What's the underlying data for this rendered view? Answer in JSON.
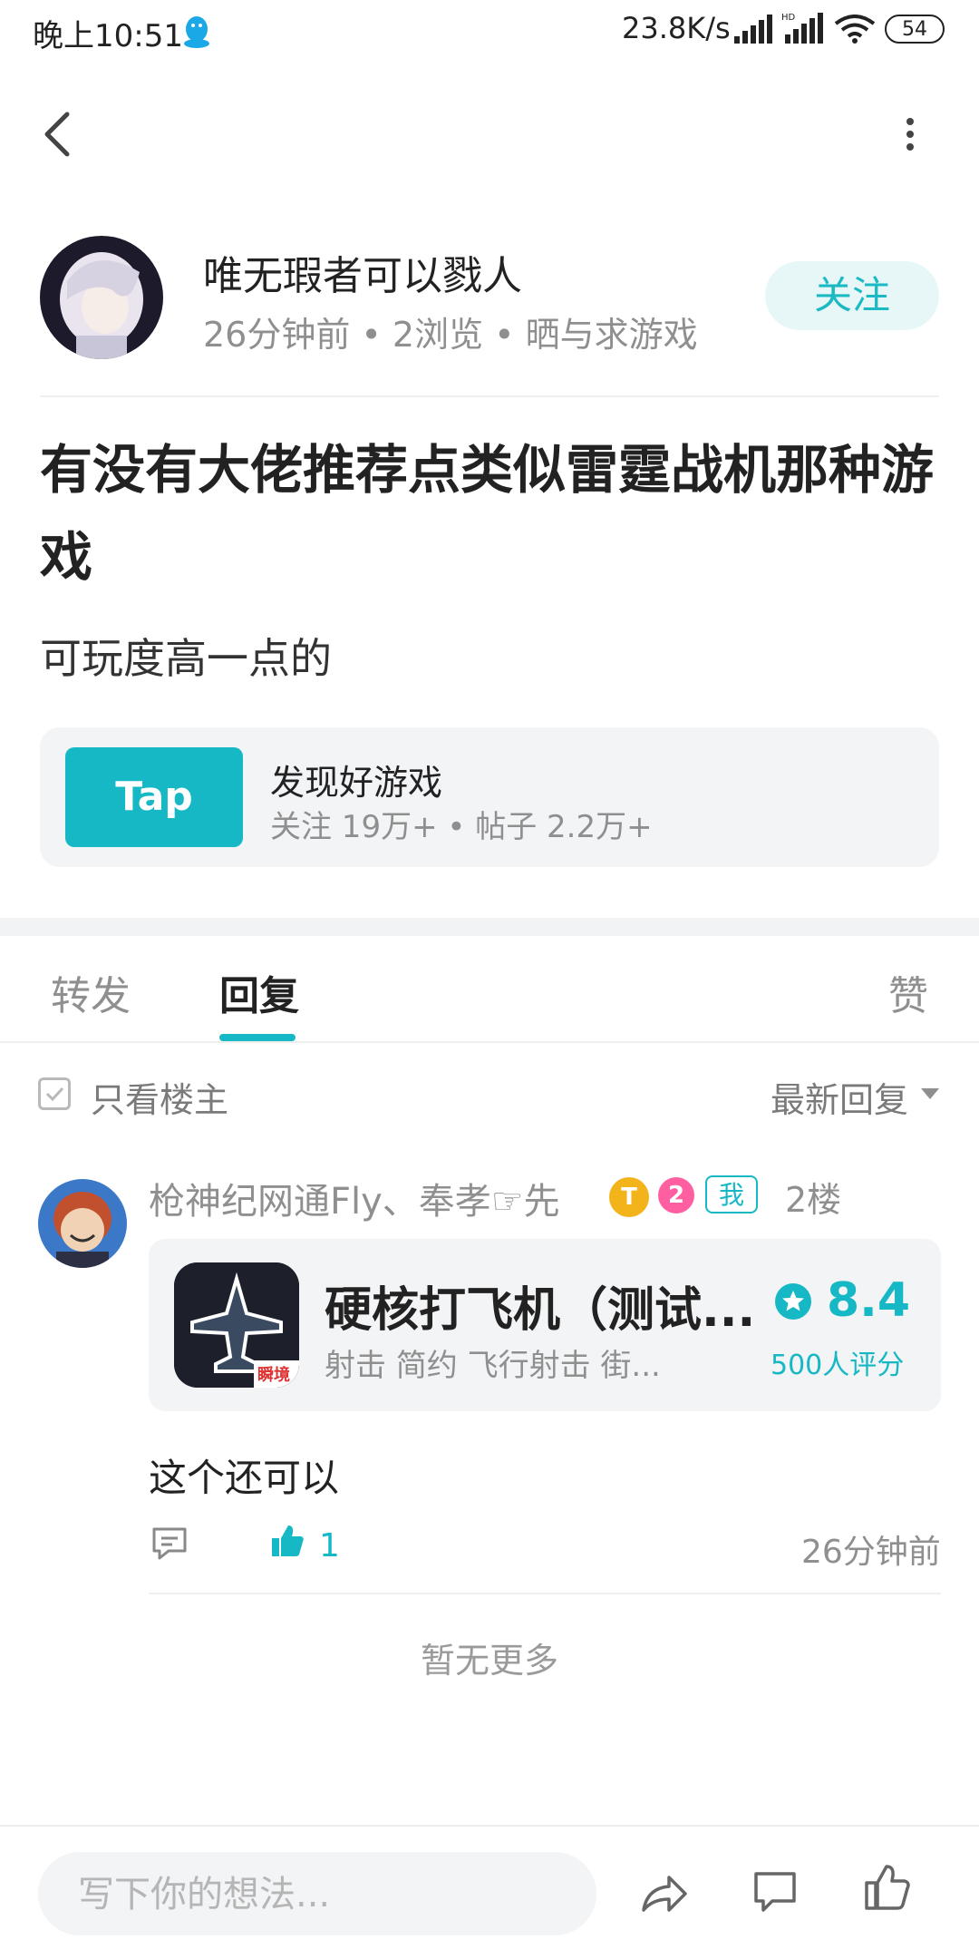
{
  "status_bar": {
    "time": "晚上10:51",
    "net_speed": "23.8K/s",
    "battery": "54"
  },
  "author": {
    "name": "唯无瑕者可以戮人",
    "meta": "26分钟前 • 2浏览 • 晒与求游戏",
    "follow_label": "关注"
  },
  "post": {
    "title": "有没有大佬推荐点类似雷霆战机那种游戏",
    "body": "可玩度高一点的"
  },
  "topic": {
    "logo_text": "Tap",
    "name": "发现好游戏",
    "stats": "关注 19万+ • 帖子 2.2万+"
  },
  "tabs": {
    "repost": "转发",
    "reply": "回复",
    "like": "赞"
  },
  "filter": {
    "only_op": "只看楼主",
    "sort": "最新回复"
  },
  "reply": {
    "user": "枪神纪网通Fly、奉孝☞先",
    "badge_t": "T",
    "badge_level": "2",
    "badge_me": "我",
    "floor": "2楼",
    "game": {
      "icon_label": "瞬境",
      "title": "硬核打飞机（测试...",
      "tags": "射击  简约  飞行射击  街...",
      "rating": "8.4",
      "rating_count": "500人评分"
    },
    "text": "这个还可以",
    "like_count": "1",
    "time": "26分钟前"
  },
  "no_more": "暂无更多",
  "bottom_bar": {
    "input_placeholder": "写下你的想法..."
  },
  "colors": {
    "accent": "#15b8c4",
    "follow_bg": "#e7f7f7",
    "card_bg": "#f3f4f6"
  }
}
